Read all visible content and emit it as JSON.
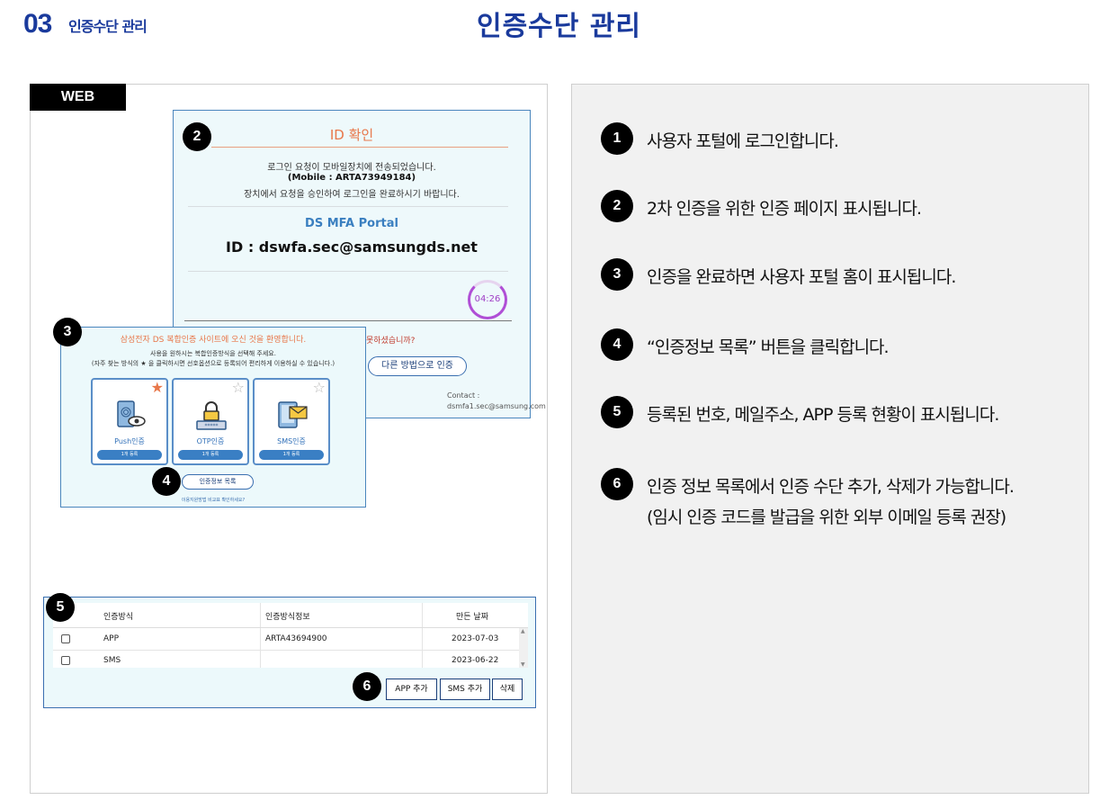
{
  "header": {
    "section_number": "03",
    "section_label": "인증수단 관리",
    "title": "인증수단 관리"
  },
  "web_panel": {
    "tag": "WEB"
  },
  "id_check": {
    "title": "ID 확인",
    "message_line1": "로그인 요청이 모바일장치에 전송되었습니다.",
    "mobile": "(Mobile : ARTA73949184)",
    "message_line2": "장치에서 요청을 승인하여 로그인을 완료하시기 바랍니다.",
    "portal_name": "DS MFA Portal",
    "user_id": "ID : dswfa.sec@samsungds.net",
    "timer": "04:26",
    "question_fragment": "못하셨습니까?",
    "alt_method_button": "다른 방법으로 인증",
    "contact_label": "Contact :",
    "contact_email": "dsmfa1.sec@samsung.com"
  },
  "portal": {
    "welcome": "삼성전자 DS 복합인증 사이트에 오신 것을 환영합니다.",
    "desc_line1": "사용을 원하시는 복합인증방식을 선택해 주세요.",
    "desc_line2": "(자주 찾는 방식의 ★ 을 클릭하시면 선호옵션으로 등록되어 편리하게 이용하실 수 있습니다.)",
    "methods": [
      {
        "label": "Push인증",
        "button": "1개 등록",
        "starred": true,
        "icon": "fingerprint-phone-icon"
      },
      {
        "label": "OTP인증",
        "button": "1개 등록",
        "starred": false,
        "icon": "lock-otp-icon"
      },
      {
        "label": "SMS인증",
        "button": "1개 등록",
        "starred": false,
        "icon": "sms-envelope-icon"
      }
    ],
    "info_list_button": "인증정보 목록",
    "small_link": "이용지원방법 비교표 확인하세요?"
  },
  "auth_table": {
    "columns": [
      "인증방식",
      "인증방식정보",
      "만든 날짜"
    ],
    "rows": [
      {
        "method": "APP",
        "info": "ARTA43694900",
        "date": "2023-07-03"
      },
      {
        "method": "SMS",
        "info": "",
        "date": "2023-06-22"
      }
    ],
    "buttons": {
      "add_app": "APP 추가",
      "add_sms": "SMS 추가",
      "delete": "삭제"
    }
  },
  "badges": {
    "b2": "2",
    "b3": "3",
    "b4": "4",
    "b5": "5",
    "b6": "6"
  },
  "steps": [
    {
      "num": "1",
      "text": "사용자 포털에 로그인합니다."
    },
    {
      "num": "2",
      "text": "2차 인증을 위한 인증 페이지 표시됩니다."
    },
    {
      "num": "3",
      "text": "인증을 완료하면 사용자 포털 홈이 표시됩니다."
    },
    {
      "num": "4",
      "text": " “인증정보 목록” 버튼을 클릭합니다."
    },
    {
      "num": "5",
      "text": "등록된 번호, 메일주소, APP 등록 현황이 표시됩니다."
    },
    {
      "num": "6",
      "text": "인증 정보 목록에서 인증 수단 추가, 삭제가 가능합니다.",
      "text2": "(임시 인증 코드를 발급을 위한 외부 이메일 등록 권장)"
    }
  ],
  "colors": {
    "brand_blue": "#1a3a9c",
    "accent_orange": "#e8774a",
    "timer_purple": "#b04fd6",
    "card_bg": "#ecf9fb",
    "panel_gray": "#f1f1f1"
  }
}
